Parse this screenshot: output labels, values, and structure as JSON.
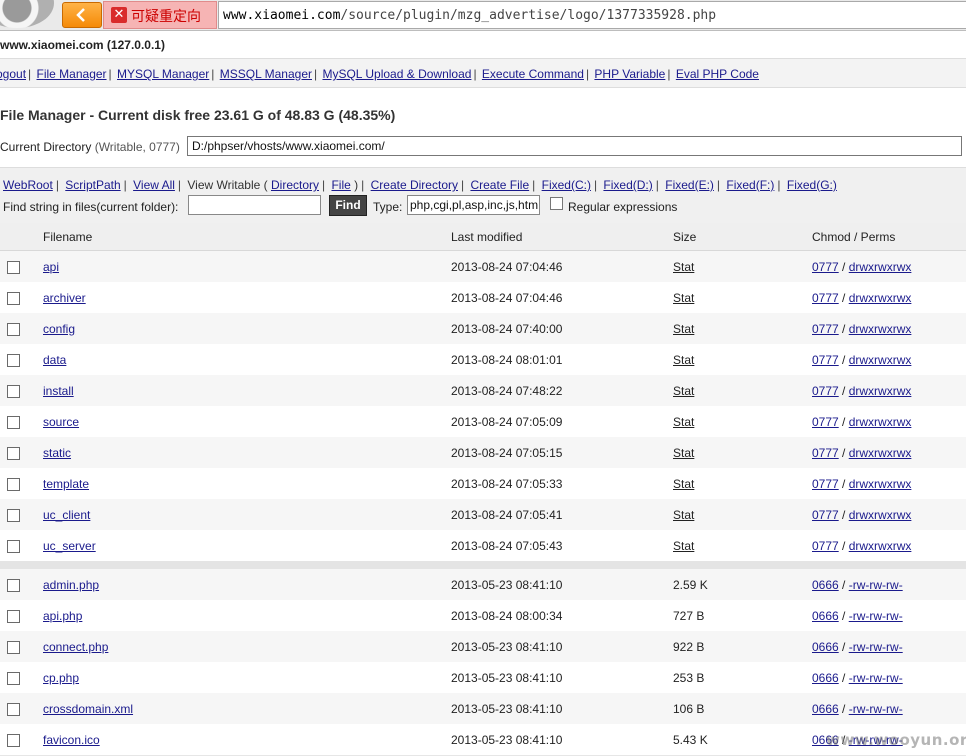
{
  "browser": {
    "warning_text": "可疑重定向",
    "url_host": "www.xiaomei.com",
    "url_path": "/source/plugin/mzg_advertise/logo/1377335928.php"
  },
  "host_line": "www.xiaomei.com (127.0.0.1)",
  "nav": [
    "ogout",
    "File Manager",
    "MYSQL Manager",
    "MSSQL Manager",
    "MySQL Upload & Download",
    "Execute Command",
    "PHP Variable",
    "Eval PHP Code"
  ],
  "title": "File Manager - Current disk free 23.61 G of 48.83 G (48.35%)",
  "current_dir": {
    "label_main": "Current Directory",
    "label_meta": "(Writable, 0777)",
    "value": "D:/phpser/vhosts/www.xiaomei.com/"
  },
  "toolbar": {
    "webroot": "WebRoot",
    "scriptpath": "ScriptPath",
    "view_all": "View All",
    "view_writable": "View Writable (",
    "directory": "Directory",
    "file": "File",
    "close_paren": ")",
    "create_directory": "Create Directory",
    "create_file": "Create File",
    "drives": [
      "Fixed(C:)",
      "Fixed(D:)",
      "Fixed(E:)",
      "Fixed(F:)",
      "Fixed(G:)"
    ],
    "find_label": "Find string in files(current folder):",
    "find_button": "Find",
    "type_label": "Type:",
    "type_value": "php,cgi,pl,asp,inc,js,htm",
    "regex_label": "Regular expressions"
  },
  "columns": {
    "filename": "Filename",
    "modified": "Last modified",
    "size": "Size",
    "perms": "Chmod / Perms"
  },
  "directories": [
    {
      "name": "api",
      "modified": "2013-08-24 07:04:46",
      "size": "Stat",
      "chmod": "0777",
      "perms": "drwxrwxrwx"
    },
    {
      "name": "archiver",
      "modified": "2013-08-24 07:04:46",
      "size": "Stat",
      "chmod": "0777",
      "perms": "drwxrwxrwx"
    },
    {
      "name": "config",
      "modified": "2013-08-24 07:40:00",
      "size": "Stat",
      "chmod": "0777",
      "perms": "drwxrwxrwx"
    },
    {
      "name": "data",
      "modified": "2013-08-24 08:01:01",
      "size": "Stat",
      "chmod": "0777",
      "perms": "drwxrwxrwx"
    },
    {
      "name": "install",
      "modified": "2013-08-24 07:48:22",
      "size": "Stat",
      "chmod": "0777",
      "perms": "drwxrwxrwx"
    },
    {
      "name": "source",
      "modified": "2013-08-24 07:05:09",
      "size": "Stat",
      "chmod": "0777",
      "perms": "drwxrwxrwx"
    },
    {
      "name": "static",
      "modified": "2013-08-24 07:05:15",
      "size": "Stat",
      "chmod": "0777",
      "perms": "drwxrwxrwx"
    },
    {
      "name": "template",
      "modified": "2013-08-24 07:05:33",
      "size": "Stat",
      "chmod": "0777",
      "perms": "drwxrwxrwx"
    },
    {
      "name": "uc_client",
      "modified": "2013-08-24 07:05:41",
      "size": "Stat",
      "chmod": "0777",
      "perms": "drwxrwxrwx"
    },
    {
      "name": "uc_server",
      "modified": "2013-08-24 07:05:43",
      "size": "Stat",
      "chmod": "0777",
      "perms": "drwxrwxrwx"
    }
  ],
  "files": [
    {
      "name": "admin.php",
      "modified": "2013-05-23 08:41:10",
      "size": "2.59 K",
      "chmod": "0666",
      "perms": "-rw-rw-rw-"
    },
    {
      "name": "api.php",
      "modified": "2013-08-24 08:00:34",
      "size": "727 B",
      "chmod": "0666",
      "perms": "-rw-rw-rw-"
    },
    {
      "name": "connect.php",
      "modified": "2013-05-23 08:41:10",
      "size": "922 B",
      "chmod": "0666",
      "perms": "-rw-rw-rw-"
    },
    {
      "name": "cp.php",
      "modified": "2013-05-23 08:41:10",
      "size": "253 B",
      "chmod": "0666",
      "perms": "-rw-rw-rw-"
    },
    {
      "name": "crossdomain.xml",
      "modified": "2013-05-23 08:41:10",
      "size": "106 B",
      "chmod": "0666",
      "perms": "-rw-rw-rw-"
    },
    {
      "name": "favicon.ico",
      "modified": "2013-05-23 08:41:10",
      "size": "5.43 K",
      "chmod": "0666",
      "perms": "-rw-rw-rw-"
    }
  ],
  "watermark": "www.wooyun.org"
}
